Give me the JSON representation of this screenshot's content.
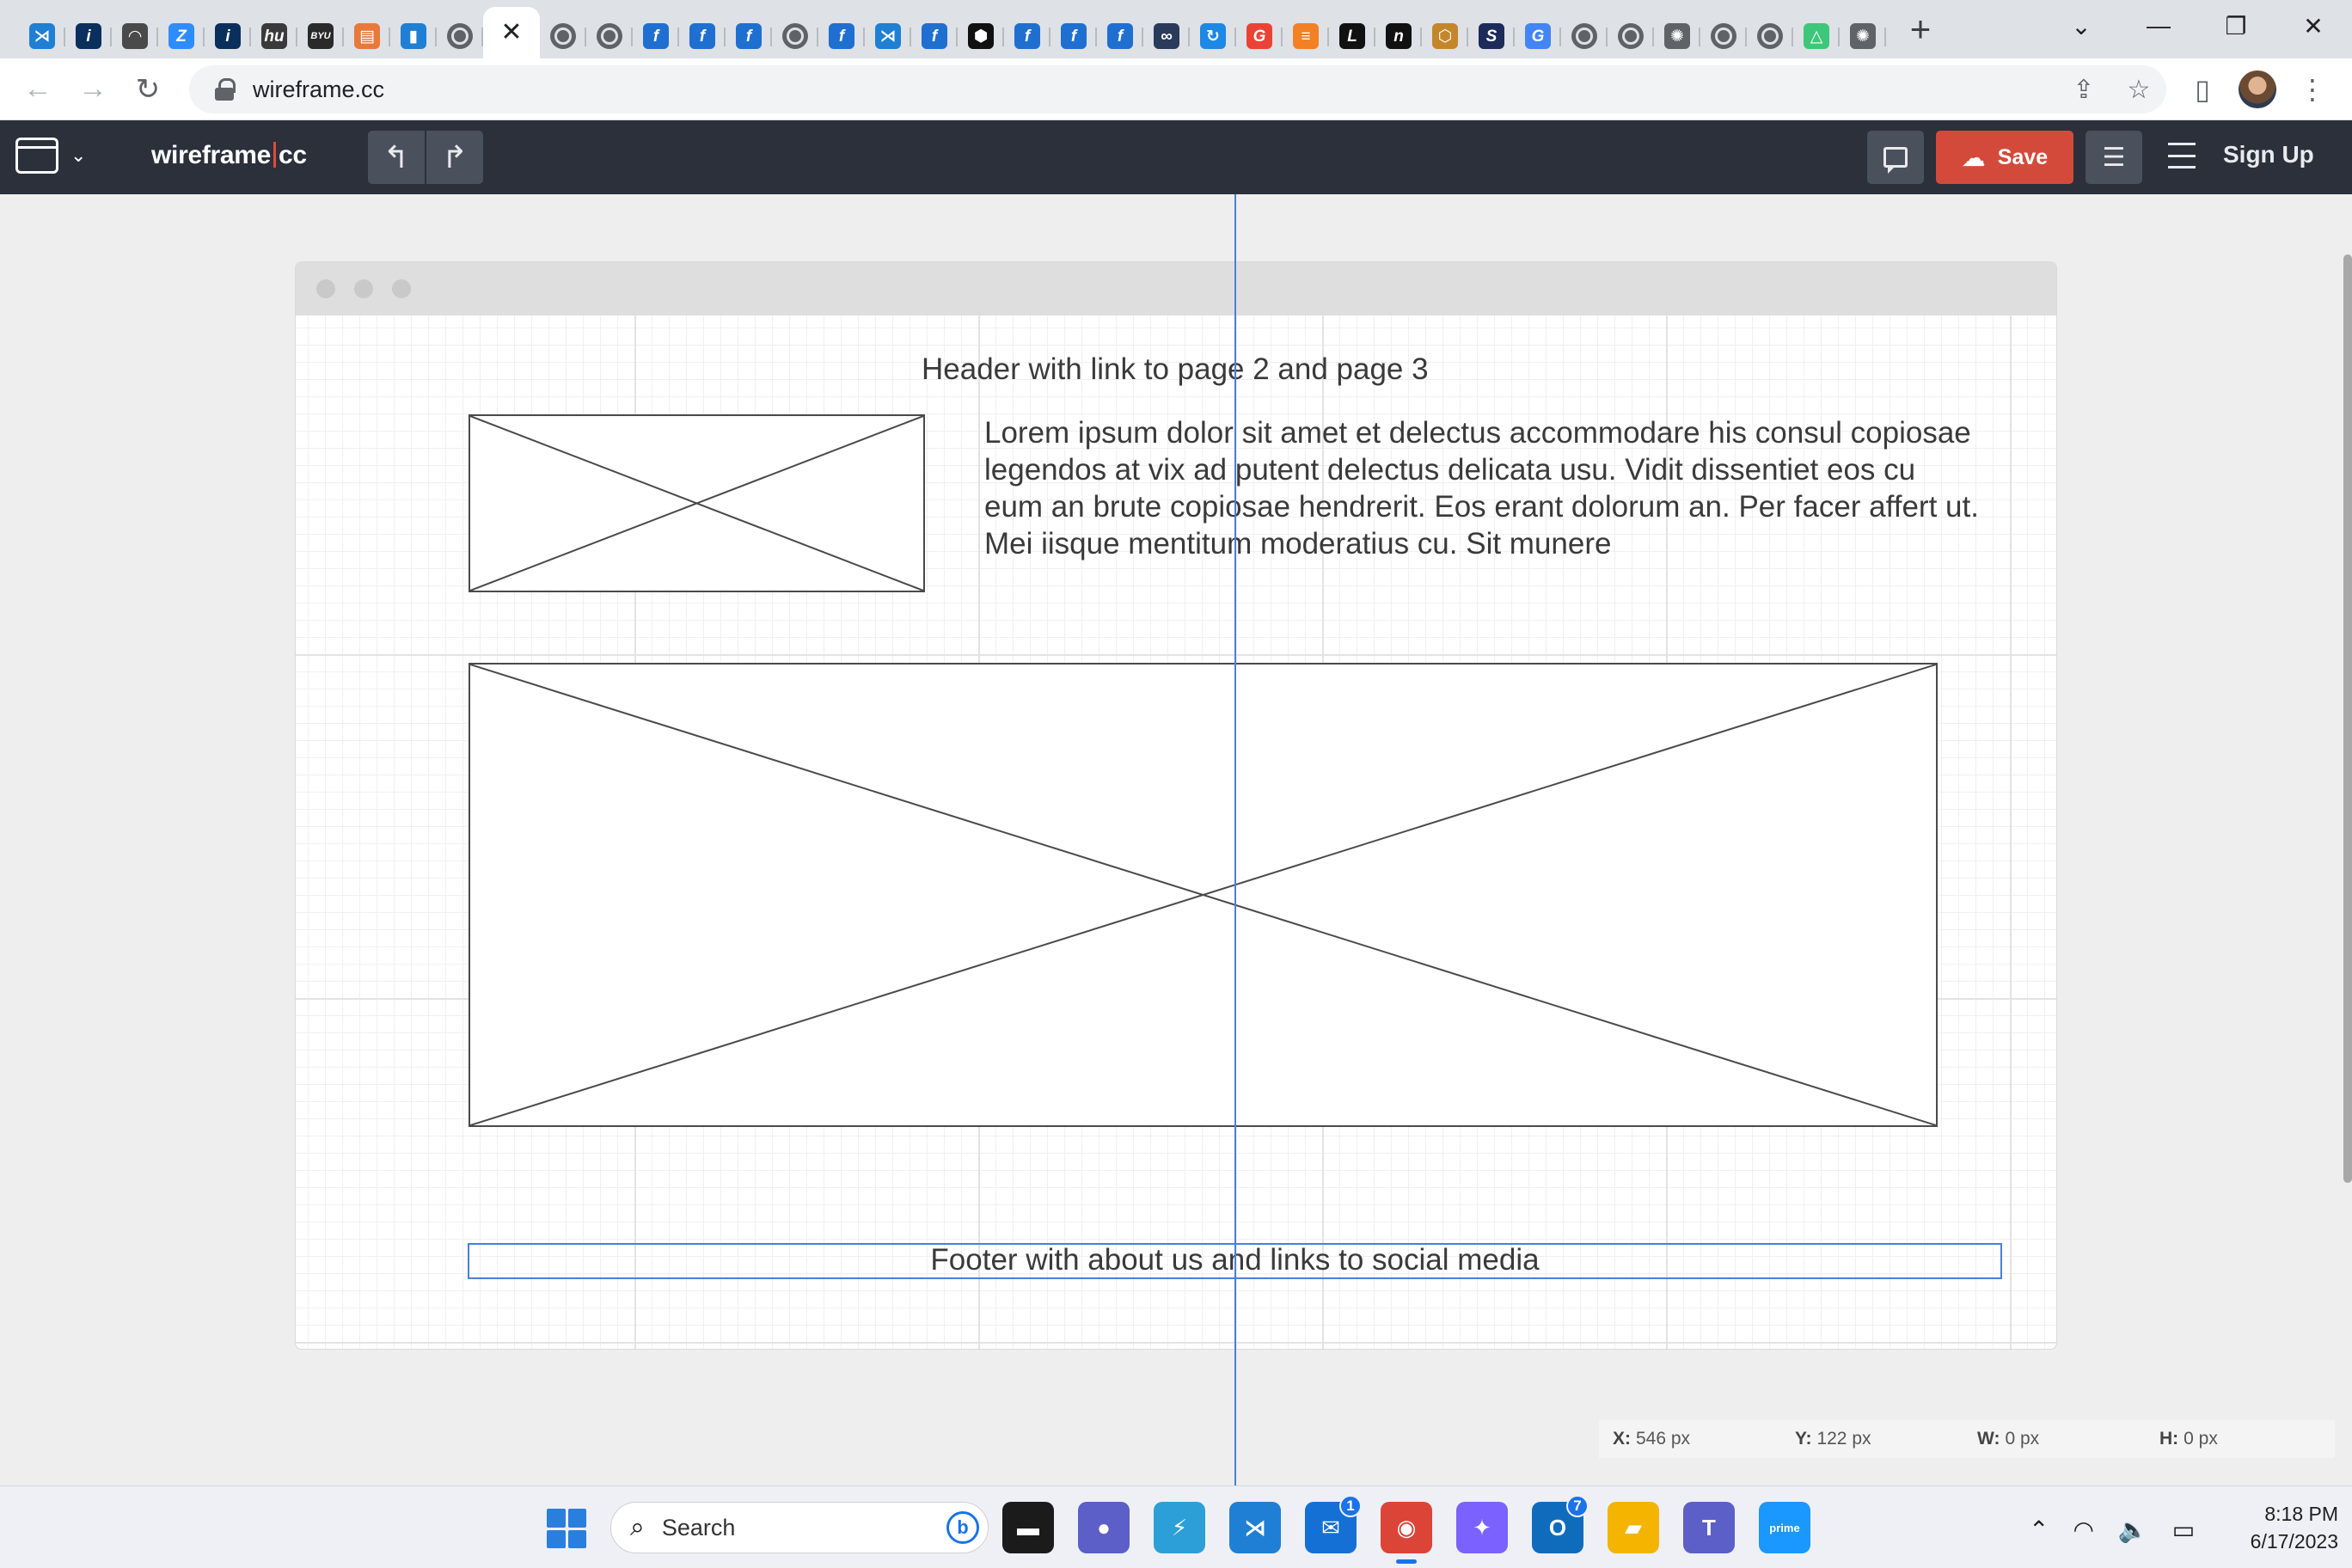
{
  "browser": {
    "tabs": [
      {
        "icon": "vscode-icon",
        "glyph": "⋊",
        "bg": "#1f7fd4"
      },
      {
        "icon": "byu-icon",
        "glyph": "i",
        "bg": "#0a2f5c"
      },
      {
        "icon": "library-icon",
        "glyph": "◠",
        "bg": "#4a4a4a"
      },
      {
        "icon": "zoom-icon",
        "glyph": "Z",
        "bg": "#2d8cff"
      },
      {
        "icon": "byu-icon",
        "glyph": "i",
        "bg": "#0a2f5c"
      },
      {
        "icon": "hu-icon",
        "glyph": "hu",
        "bg": "#3a3a3a"
      },
      {
        "icon": "byu-idaho-icon",
        "glyph": "BYU",
        "bg": "#2a2a2a"
      },
      {
        "icon": "calendar-icon",
        "glyph": "▤",
        "bg": "#e8793a"
      },
      {
        "icon": "chart-bars-icon",
        "glyph": "▮",
        "bg": "#1f7fd4"
      },
      {
        "icon": "globe-icon",
        "glyph": "",
        "bg": "globe"
      },
      {
        "icon": "close-tab-icon",
        "glyph": "✕",
        "bg": "close"
      },
      {
        "icon": "globe-icon",
        "glyph": "",
        "bg": "globe"
      },
      {
        "icon": "globe-icon",
        "glyph": "",
        "bg": "globe"
      },
      {
        "icon": "formula-icon",
        "glyph": "f",
        "bg": "#1f6fd1"
      },
      {
        "icon": "formula-icon",
        "glyph": "f",
        "bg": "#1f6fd1"
      },
      {
        "icon": "formula-icon",
        "glyph": "f",
        "bg": "#1f6fd1"
      },
      {
        "icon": "globe-icon",
        "glyph": "",
        "bg": "globe"
      },
      {
        "icon": "formula-icon",
        "glyph": "f",
        "bg": "#1f6fd1"
      },
      {
        "icon": "vscode-icon",
        "glyph": "⋊",
        "bg": "#1f7fd4"
      },
      {
        "icon": "formula-icon",
        "glyph": "f",
        "bg": "#1f6fd1"
      },
      {
        "icon": "codesandbox-icon",
        "glyph": "⬢",
        "bg": "#111111"
      },
      {
        "icon": "formula-icon",
        "glyph": "f",
        "bg": "#1f6fd1"
      },
      {
        "icon": "formula-icon",
        "glyph": "f",
        "bg": "#1f6fd1"
      },
      {
        "icon": "formula-icon",
        "glyph": "f",
        "bg": "#1f6fd1"
      },
      {
        "icon": "infinity-icon",
        "glyph": "∞",
        "bg": "#2a3a5a"
      },
      {
        "icon": "sync-icon",
        "glyph": "↻",
        "bg": "#1e88e5"
      },
      {
        "icon": "google-icon",
        "glyph": "G",
        "bg": "#ea4335"
      },
      {
        "icon": "stackoverflow-icon",
        "glyph": "≡",
        "bg": "#f48024"
      },
      {
        "icon": "l-icon",
        "glyph": "L",
        "bg": "#111111"
      },
      {
        "icon": "notion-icon",
        "glyph": "n",
        "bg": "#111111"
      },
      {
        "icon": "hex-icon",
        "glyph": "⬡",
        "bg": "#c5862b"
      },
      {
        "icon": "circle-s-icon",
        "glyph": "S",
        "bg": "#1c2b5a"
      },
      {
        "icon": "google-icon",
        "glyph": "G",
        "bg": "#4285f4"
      },
      {
        "icon": "globe-icon",
        "glyph": "",
        "bg": "globe"
      },
      {
        "icon": "globe-icon",
        "glyph": "",
        "bg": "globe"
      },
      {
        "icon": "openai-icon",
        "glyph": "✺",
        "bg": "#5f6368"
      },
      {
        "icon": "globe-icon",
        "glyph": "",
        "bg": "globe"
      },
      {
        "icon": "globe-icon",
        "glyph": "",
        "bg": "globe"
      },
      {
        "icon": "drive-icon",
        "glyph": "△",
        "bg": "#3ec77a"
      },
      {
        "icon": "openai-icon",
        "glyph": "✺",
        "bg": "#5f6368"
      }
    ],
    "new_tab_glyph": "+",
    "url": "wireframe.cc"
  },
  "app": {
    "logo_left": "wireframe",
    "logo_right": "cc",
    "save_label": "Save",
    "signup_label": "Sign Up",
    "accent_color": "#d44a3a"
  },
  "canvas": {
    "header_text": "Header with link to page 2 and page 3",
    "lorem_text": "Lorem ipsum dolor sit amet et delectus accommodare his consul copiosae legendos at vix ad putent delectus delicata usu. Vidit dissentiet eos cu eum an brute copiosae hendrerit. Eos erant dolorum an. Per facer affert ut. Mei iisque mentitum moderatius cu. Sit munere",
    "footer_text": "Footer with about us and links to social media"
  },
  "status": {
    "x_label": "X:",
    "x_value": "546 px",
    "y_label": "Y:",
    "y_value": "122 px",
    "w_label": "W:",
    "w_value": "0 px",
    "h_label": "H:",
    "h_value": "0 px"
  },
  "taskbar": {
    "search_label": "Search",
    "apps": [
      {
        "icon": "files-icon",
        "glyph": "▬",
        "bg": "#1b1b1b",
        "badge": ""
      },
      {
        "icon": "chat-icon",
        "glyph": "●",
        "bg": "#5b5fc7",
        "badge": ""
      },
      {
        "icon": "power-automate-icon",
        "glyph": "⚡",
        "bg": "#2d9fd8",
        "badge": ""
      },
      {
        "icon": "vscode-icon",
        "glyph": "⋊",
        "bg": "#1f7fd4",
        "badge": ""
      },
      {
        "icon": "mail-icon",
        "glyph": "✉",
        "bg": "#1570d6",
        "badge": "1"
      },
      {
        "icon": "chrome-icon",
        "glyph": "◉",
        "bg": "#db4437",
        "badge": ""
      },
      {
        "icon": "copilot-icon",
        "glyph": "✦",
        "bg": "#7b61ff",
        "badge": ""
      },
      {
        "icon": "outlook-icon",
        "glyph": "O",
        "bg": "#0f6cbd",
        "badge": "7"
      },
      {
        "icon": "file-explorer-icon",
        "glyph": "▰",
        "bg": "#f4b400",
        "badge": ""
      },
      {
        "icon": "teams-icon",
        "glyph": "T",
        "bg": "#5b5fc7",
        "badge": ""
      },
      {
        "icon": "prime-video-icon",
        "glyph": "prime",
        "bg": "#1a98ff",
        "badge": ""
      }
    ],
    "time": "8:18 PM",
    "date": "6/17/2023"
  }
}
